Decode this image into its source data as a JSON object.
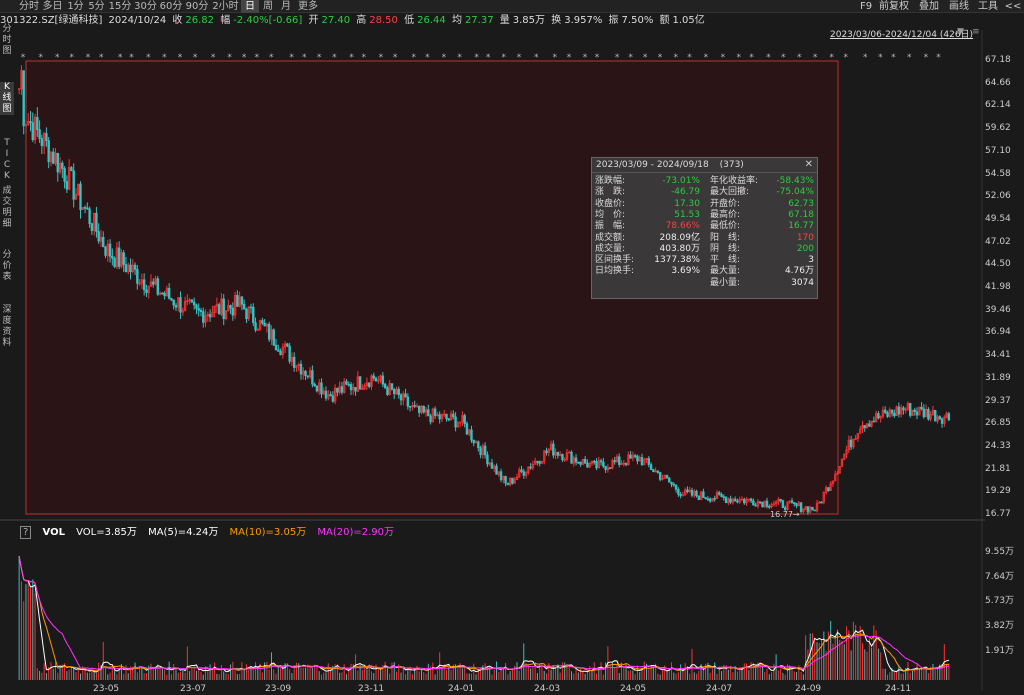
{
  "toolbar": {
    "tabs": [
      "分时",
      "多日",
      "1分",
      "5分",
      "15分",
      "30分",
      "60分",
      "90分",
      "2小时",
      "日",
      "周",
      "月",
      "更多"
    ],
    "active_tab": "日",
    "right_buttons": [
      "F9",
      "前复权",
      "叠加",
      "画线",
      "工具",
      "<<"
    ]
  },
  "info": {
    "code": "301322.SZ[绿通科技]",
    "date": "2024/10/24",
    "close_label": "收",
    "close": "26.82",
    "change_label": "幅",
    "change": "-2.40%[-0.66]",
    "open_label": "开",
    "open": "27.40",
    "high_label": "高",
    "high": "28.50",
    "low_label": "低",
    "low": "26.44",
    "avg_label": "均",
    "avg": "27.37",
    "volume_label": "量",
    "volume": "3.85万",
    "turnover_label": "换",
    "turnover": "3.957%",
    "amplitude_label": "振",
    "amplitude": "7.50%",
    "amount_label": "额",
    "amount": "1.05亿"
  },
  "range": {
    "text": "2023/03/06-2024/12/04 (426日)",
    "arrow": "▼",
    "menu": "≡"
  },
  "side_tabs": [
    "分时图",
    "K线图",
    "TICK",
    "成交明细",
    "分价表",
    "深度资料"
  ],
  "price_axis": [
    "67.18",
    "64.66",
    "62.14",
    "59.62",
    "57.10",
    "54.58",
    "52.06",
    "49.54",
    "47.02",
    "44.50",
    "41.98",
    "39.46",
    "36.94",
    "34.41",
    "31.89",
    "29.37",
    "26.85",
    "24.33",
    "21.81",
    "19.29",
    "16.77"
  ],
  "volume_axis": [
    "9.55万",
    "7.64万",
    "5.73万",
    "3.82万",
    "1.91万"
  ],
  "x_axis": [
    "23-05",
    "23-07",
    "23-09",
    "23-11",
    "24-01",
    "24-03",
    "24-05",
    "24-07",
    "24-09",
    "24-11"
  ],
  "low_marker": "16.77",
  "popup": {
    "date_from": "2023/03/09",
    "date_to": "2024/09/18",
    "count": "(373)",
    "close_icon": "✕",
    "left": [
      {
        "label": "涨跌幅:",
        "value": "-73.01%",
        "color": "#2ecc40"
      },
      {
        "label": "涨　跌:",
        "value": "-46.79",
        "color": "#2ecc40"
      },
      {
        "label": "收盘价:",
        "value": "17.30",
        "color": "#2ecc40"
      },
      {
        "label": "均　价:",
        "value": "51.53",
        "color": "#2ecc40"
      },
      {
        "label": "振　幅:",
        "value": "78.66%",
        "color": "#ff4040"
      },
      {
        "label": "成交额:",
        "value": "208.09亿",
        "color": "#eeeeee"
      },
      {
        "label": "成交量:",
        "value": "403.80万",
        "color": "#eeeeee"
      },
      {
        "label": "区间换手:",
        "value": "1377.38%",
        "color": "#eeeeee"
      },
      {
        "label": "日均换手:",
        "value": "3.69%",
        "color": "#eeeeee"
      }
    ],
    "right": [
      {
        "label": "年化收益率:",
        "value": "-58.43%",
        "color": "#2ecc40"
      },
      {
        "label": "最大回撤:",
        "value": "-75.04%",
        "color": "#2ecc40"
      },
      {
        "label": "开盘价:",
        "value": "62.73",
        "color": "#2ecc40"
      },
      {
        "label": "最高价:",
        "value": "67.18",
        "color": "#2ecc40"
      },
      {
        "label": "最低价:",
        "value": "16.77",
        "color": "#2ecc40"
      },
      {
        "label": "阳　线:",
        "value": "170",
        "color": "#ff4040"
      },
      {
        "label": "阴　线:",
        "value": "200",
        "color": "#2ecc40"
      },
      {
        "label": "平　线:",
        "value": "3",
        "color": "#eeeeee"
      },
      {
        "label": "最大量:",
        "value": "4.76万",
        "color": "#eeeeee"
      },
      {
        "label": "最小量:",
        "value": "3074",
        "color": "#eeeeee"
      }
    ]
  },
  "volume": {
    "help_icon": "?",
    "title": "VOL",
    "vol_text": "VOL=3.85万",
    "ma5_text": "MA(5)=4.24万",
    "ma10_text": "MA(10)=3.05万",
    "ma20_text": "MA(20)=2.90万",
    "vol_color": "#ffffff",
    "ma5_color": "#ffffff",
    "ma10_color": "#ff9900",
    "ma20_color": "#ff33ff"
  },
  "colors": {
    "up": "#ff3030",
    "down": "#36c2c2",
    "selection_border": "#c03030",
    "selection_fill": "#2a1416"
  },
  "chart_data": {
    "type": "candlestick",
    "title": "",
    "xlabel": "",
    "ylabel": "",
    "ylim": [
      16.77,
      67.18
    ],
    "x_ticks": [
      "23-05",
      "23-07",
      "23-09",
      "23-11",
      "24-01",
      "24-03",
      "24-05",
      "24-07",
      "24-09",
      "24-11"
    ],
    "close_path_approx": [
      [
        "2023-03",
        62
      ],
      [
        "2023-04",
        55
      ],
      [
        "2023-05",
        46
      ],
      [
        "2023-06",
        42
      ],
      [
        "2023-07",
        39
      ],
      [
        "2023-08",
        40
      ],
      [
        "2023-09",
        35
      ],
      [
        "2023-10",
        30
      ],
      [
        "2023-11",
        32
      ],
      [
        "2023-12",
        28
      ],
      [
        "2024-01",
        27
      ],
      [
        "2024-02",
        20
      ],
      [
        "2024-03",
        24
      ],
      [
        "2024-04",
        22
      ],
      [
        "2024-05",
        23
      ],
      [
        "2024-06",
        19
      ],
      [
        "2024-07",
        18.5
      ],
      [
        "2024-08",
        18
      ],
      [
        "2024-09",
        17.3
      ],
      [
        "2024-10",
        26.8
      ],
      [
        "2024-11",
        28.5
      ],
      [
        "2024-12",
        27.5
      ]
    ],
    "volume_series": [
      {
        "name": "VOL",
        "last": "3.85万"
      },
      {
        "name": "MA(5)",
        "last": "4.24万"
      },
      {
        "name": "MA(10)",
        "last": "3.05万"
      },
      {
        "name": "MA(20)",
        "last": "2.90万"
      }
    ]
  }
}
